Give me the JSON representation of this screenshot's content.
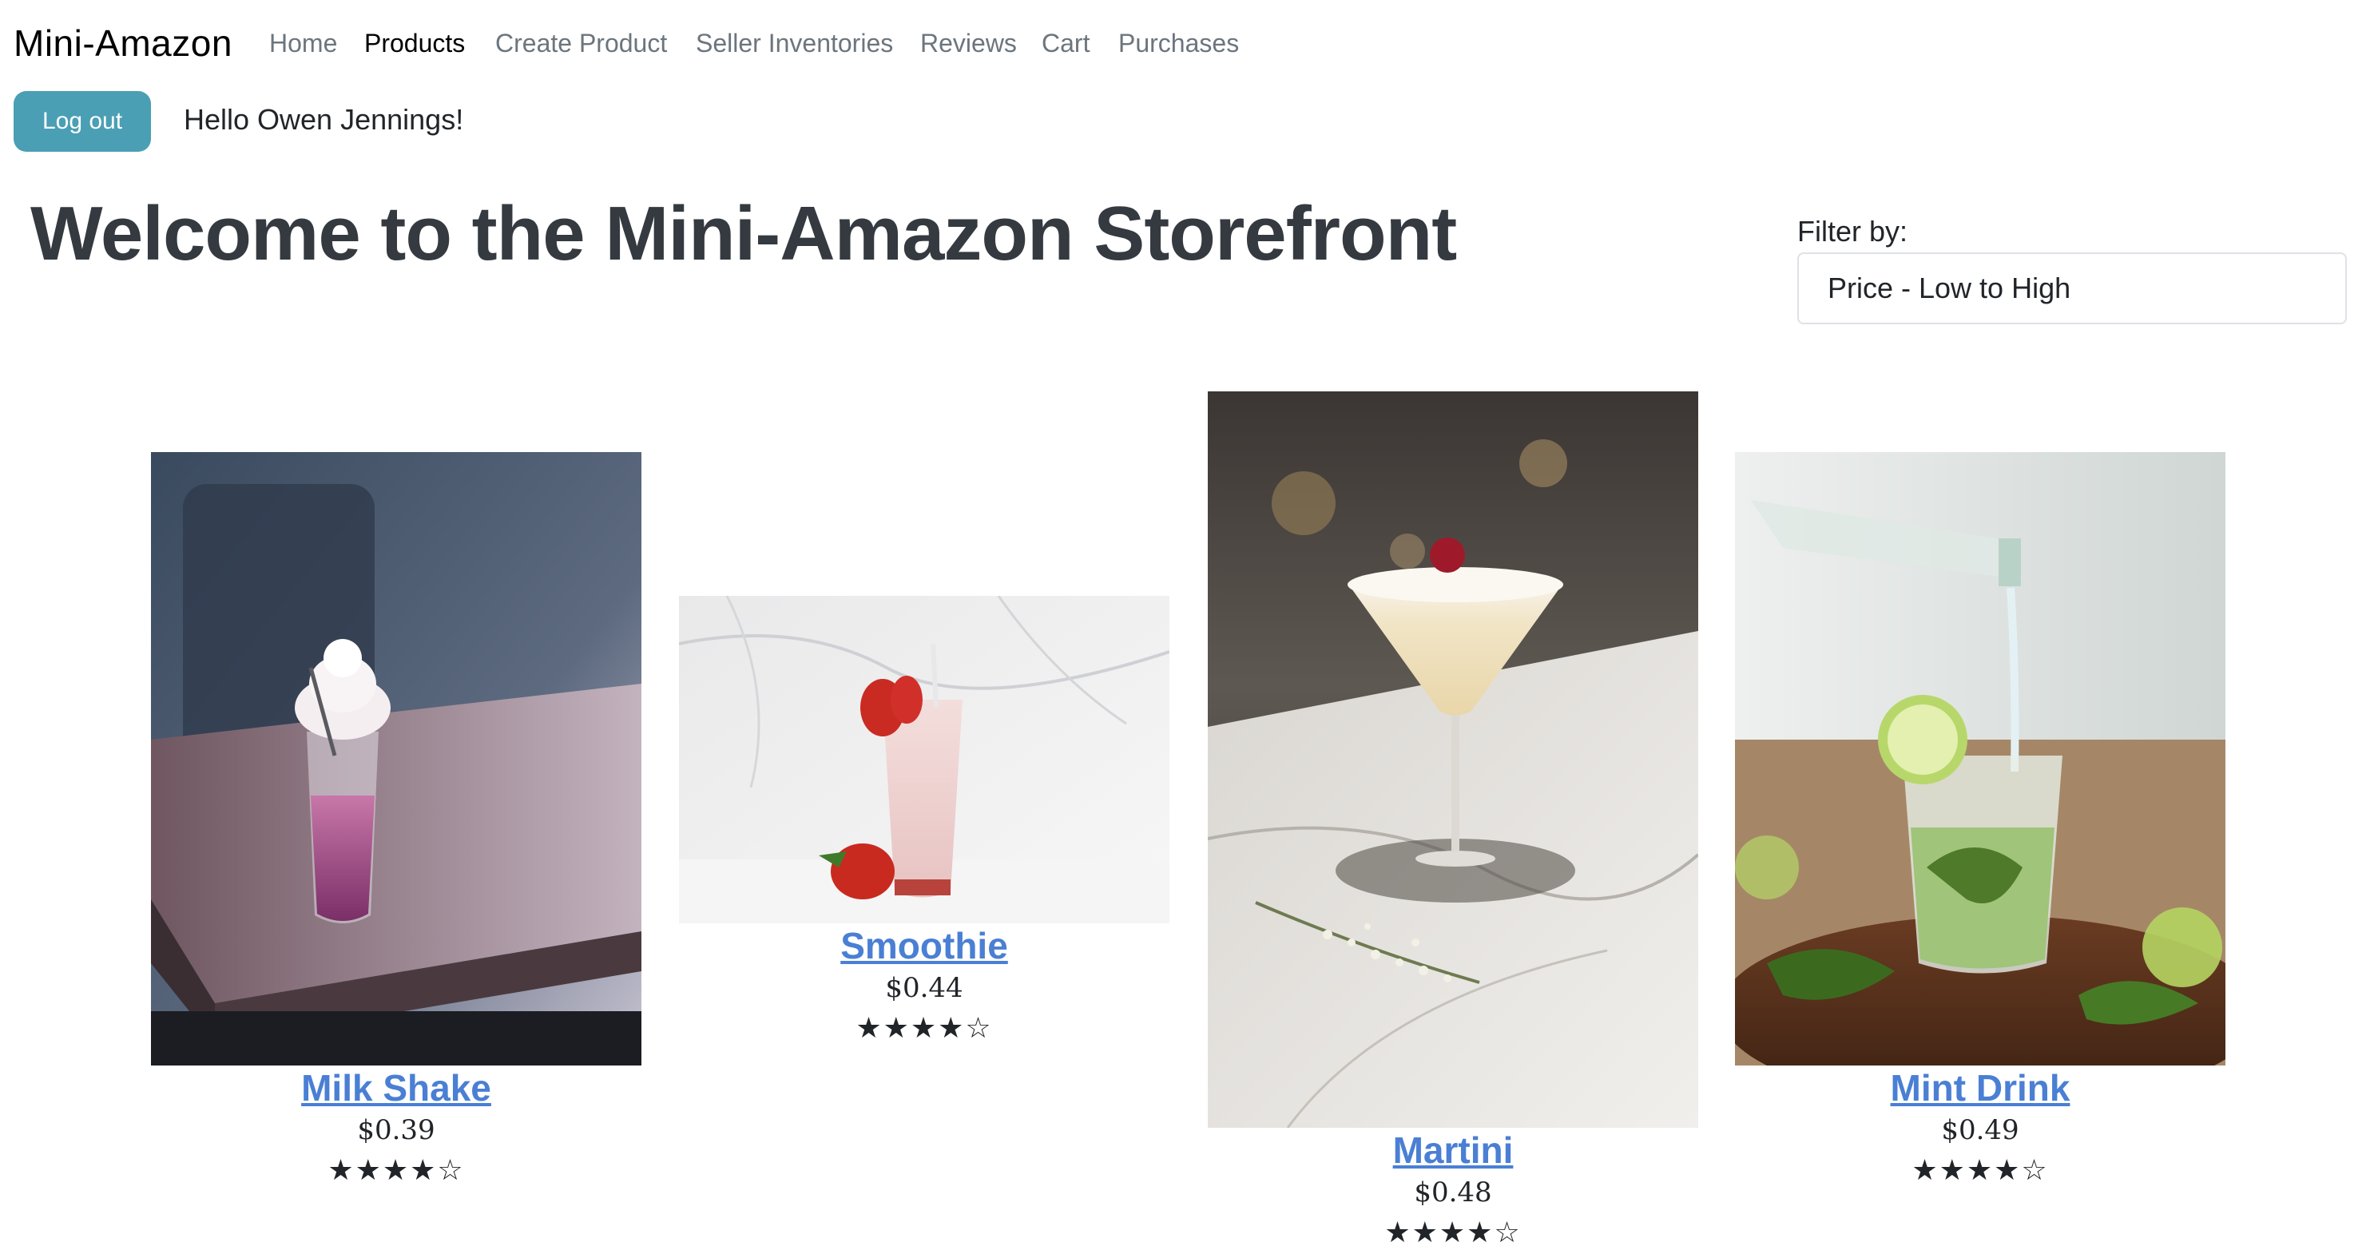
{
  "navbar": {
    "brand": "Mini-Amazon",
    "items": [
      {
        "label": "Home"
      },
      {
        "label": "Products"
      },
      {
        "label": "Create Product"
      },
      {
        "label": "Seller Inventories"
      },
      {
        "label": "Reviews"
      },
      {
        "label": "Cart"
      },
      {
        "label": "Purchases"
      }
    ],
    "active": "Products"
  },
  "user": {
    "logout_label": "Log out",
    "greeting": "Hello Owen Jennings!"
  },
  "page": {
    "title": "Welcome to the Mini-Amazon Storefront"
  },
  "filter": {
    "label": "Filter by:",
    "selected": "Price - Low to High"
  },
  "products": [
    {
      "name": "Milk Shake",
      "price": "$0.39",
      "rating_stars": "★★★★☆",
      "rating": 4,
      "image_icon": "milkshake-photo"
    },
    {
      "name": "Smoothie",
      "price": "$0.44",
      "rating_stars": "★★★★☆",
      "rating": 4,
      "image_icon": "smoothie-photo"
    },
    {
      "name": "Martini",
      "price": "$0.48",
      "rating_stars": "★★★★☆",
      "rating": 4,
      "image_icon": "martini-photo"
    },
    {
      "name": "Mint Drink",
      "price": "$0.49",
      "rating_stars": "★★★★☆",
      "rating": 4,
      "image_icon": "mint-drink-photo"
    }
  ],
  "colors": {
    "accent": "#4a9fb5",
    "link": "#4a7fd4",
    "title": "#343a40"
  }
}
